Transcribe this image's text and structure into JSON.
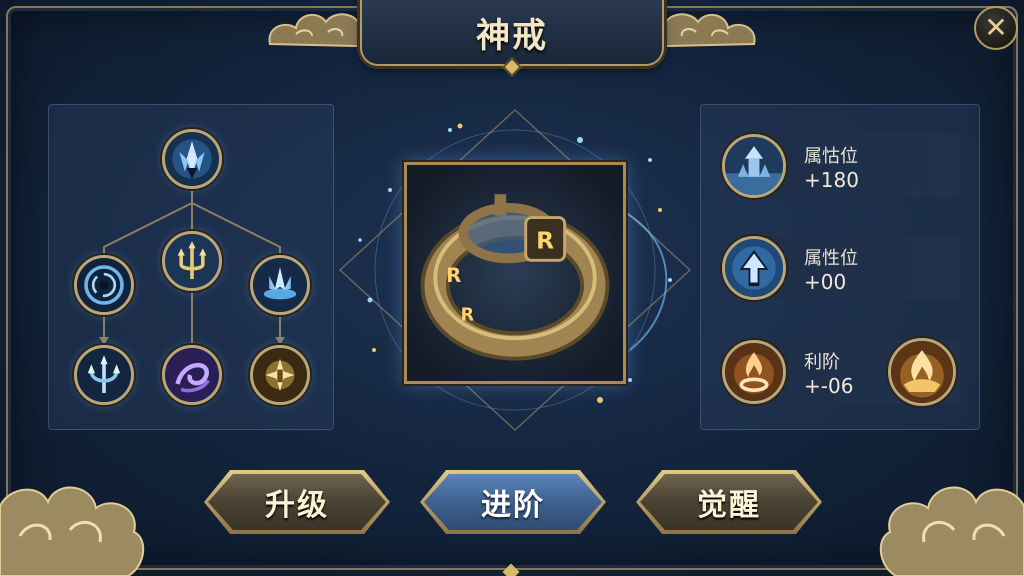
{
  "header": {
    "title": "神戒"
  },
  "close": {
    "label": "✕"
  },
  "skill_tree": {
    "nodes": [
      {
        "name": "top-crystal-skill",
        "icon": "ice-crown-icon"
      },
      {
        "name": "left-vortex-skill",
        "icon": "vortex-icon"
      },
      {
        "name": "center-trident-skill",
        "icon": "trident-icon"
      },
      {
        "name": "right-frost-skill",
        "icon": "frost-burst-icon"
      },
      {
        "name": "left-trident-skill",
        "icon": "ice-trident-icon"
      },
      {
        "name": "center-swirl-skill",
        "icon": "arcane-swirl-icon"
      },
      {
        "name": "right-sigil-skill",
        "icon": "golden-sigil-icon"
      }
    ]
  },
  "item": {
    "icon": "rune-ring-icon",
    "runes": [
      "R",
      "R",
      "R"
    ]
  },
  "stats": [
    {
      "label": "属怙位",
      "value": "+180",
      "icon": "temple-icon"
    },
    {
      "label": "属性位",
      "value": "+00",
      "icon": "arrow-up-icon"
    },
    {
      "label": "利阶",
      "value": "+-06",
      "icon": "flame-ring-icon",
      "extra_icon": "golden-flame-icon"
    }
  ],
  "buttons": {
    "upgrade": "升级",
    "advance": "进阶",
    "awaken": "觉醒"
  },
  "colors": {
    "gold": "#b59a63",
    "accent_blue": "#4a74a8",
    "bg": "#142640"
  }
}
